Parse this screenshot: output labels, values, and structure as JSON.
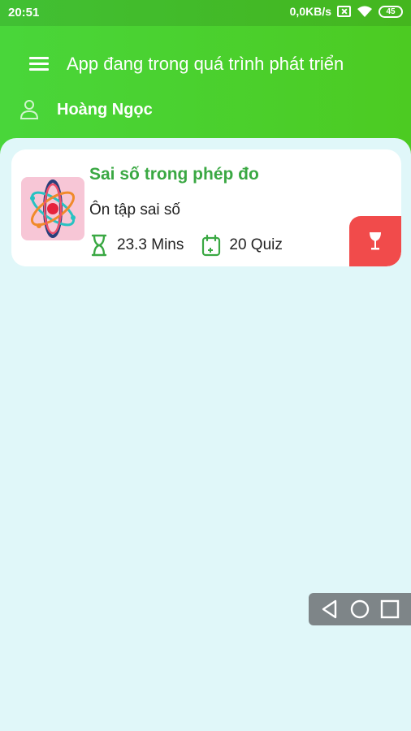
{
  "status_bar": {
    "time": "20:51",
    "network_speed": "0,0KB/s",
    "battery": "45"
  },
  "header": {
    "title": "App đang trong quá trình phát triển",
    "menu_icon": "menu-icon",
    "user_icon": "person-icon",
    "user_name": "Hoàng Ngọc"
  },
  "courses": [
    {
      "title": "Sai số trong phép đo",
      "subtitle": "Ôn tập sai số",
      "duration": "23.3 Mins",
      "quiz_count": "20 Quiz",
      "thumb_icon": "atom-icon",
      "action_icon": "wine-glass-icon"
    }
  ],
  "colors": {
    "header_green": "#4ccb22",
    "title_green": "#3aa843",
    "background": "#e0f7f9",
    "action_red": "#f14b4b"
  },
  "nav_overlay": {
    "icons": [
      "back-icon",
      "home-icon",
      "recents-icon"
    ]
  }
}
